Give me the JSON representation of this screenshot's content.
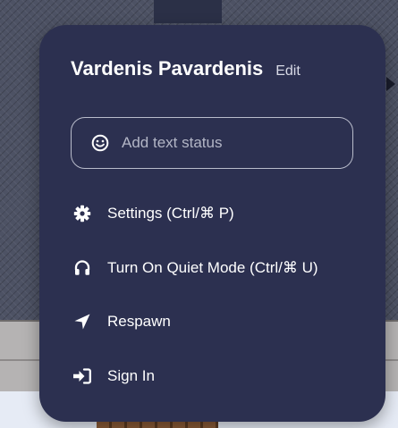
{
  "profile": {
    "name": "Vardenis Pavardenis",
    "edit_label": "Edit"
  },
  "status": {
    "placeholder": "Add text status",
    "icon": "smile-icon"
  },
  "menu": {
    "items": [
      {
        "label": "Settings (Ctrl/⌘ P)",
        "icon": "gear-icon"
      },
      {
        "label": "Turn On Quiet Mode (Ctrl/⌘ U)",
        "icon": "headphones-icon"
      },
      {
        "label": "Respawn",
        "icon": "location-arrow-icon"
      },
      {
        "label": "Sign In",
        "icon": "sign-in-icon"
      }
    ]
  },
  "colors": {
    "menu_background": "#2c3050",
    "text": "#ffffff",
    "muted_text": "#b3b6c6",
    "input_border": "#b9bccb"
  }
}
